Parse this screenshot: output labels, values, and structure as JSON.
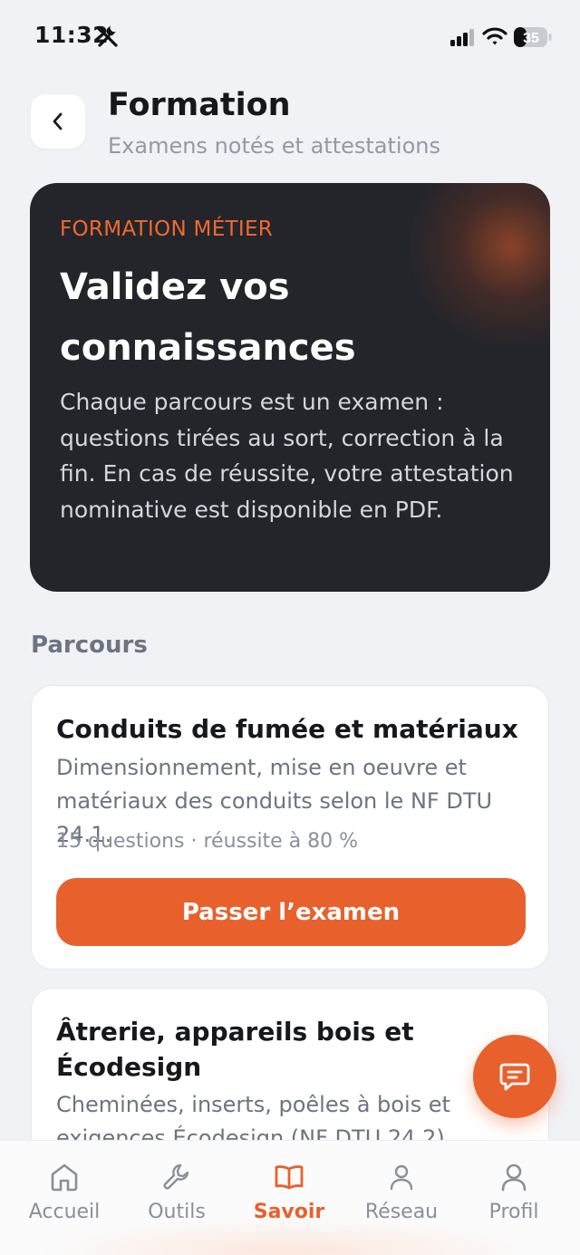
{
  "status_bar": {
    "time": "11:32",
    "battery": "35"
  },
  "header": {
    "title": "Formation",
    "subtitle": "Examens notés et attestations"
  },
  "hero": {
    "eyebrow": "FORMATION MÉTIER",
    "title": "Validez vos connaissances",
    "body": "Chaque parcours est un examen : questions tirées au sort, correction à la fin. En cas de réussite, votre attestation nominative est disponible en PDF."
  },
  "section": {
    "title": "Parcours"
  },
  "courses": [
    {
      "title": "Conduits de fumée et matériaux",
      "description": "Dimensionnement, mise en oeuvre et matériaux des conduits selon le NF DTU 24.1.",
      "meta": "15 questions · réussite à 80 %",
      "button": "Passer l’examen"
    },
    {
      "title": "Âtrerie, appareils bois et Écodesign",
      "description": "Cheminées, inserts, poêles à bois et exigences Écodesign (NF DTU 24.2)."
    }
  ],
  "nav": {
    "items": [
      {
        "label": "Accueil",
        "icon": "home-icon"
      },
      {
        "label": "Outils",
        "icon": "wrench-icon"
      },
      {
        "label": "Savoir",
        "icon": "book-icon"
      },
      {
        "label": "Réseau",
        "icon": "person-icon"
      },
      {
        "label": "Profil",
        "icon": "user-icon"
      }
    ],
    "active": "Savoir"
  },
  "colors": {
    "accent": "#e8612c",
    "hero_bg": "#23252b",
    "page_bg": "#f1f2f6"
  }
}
